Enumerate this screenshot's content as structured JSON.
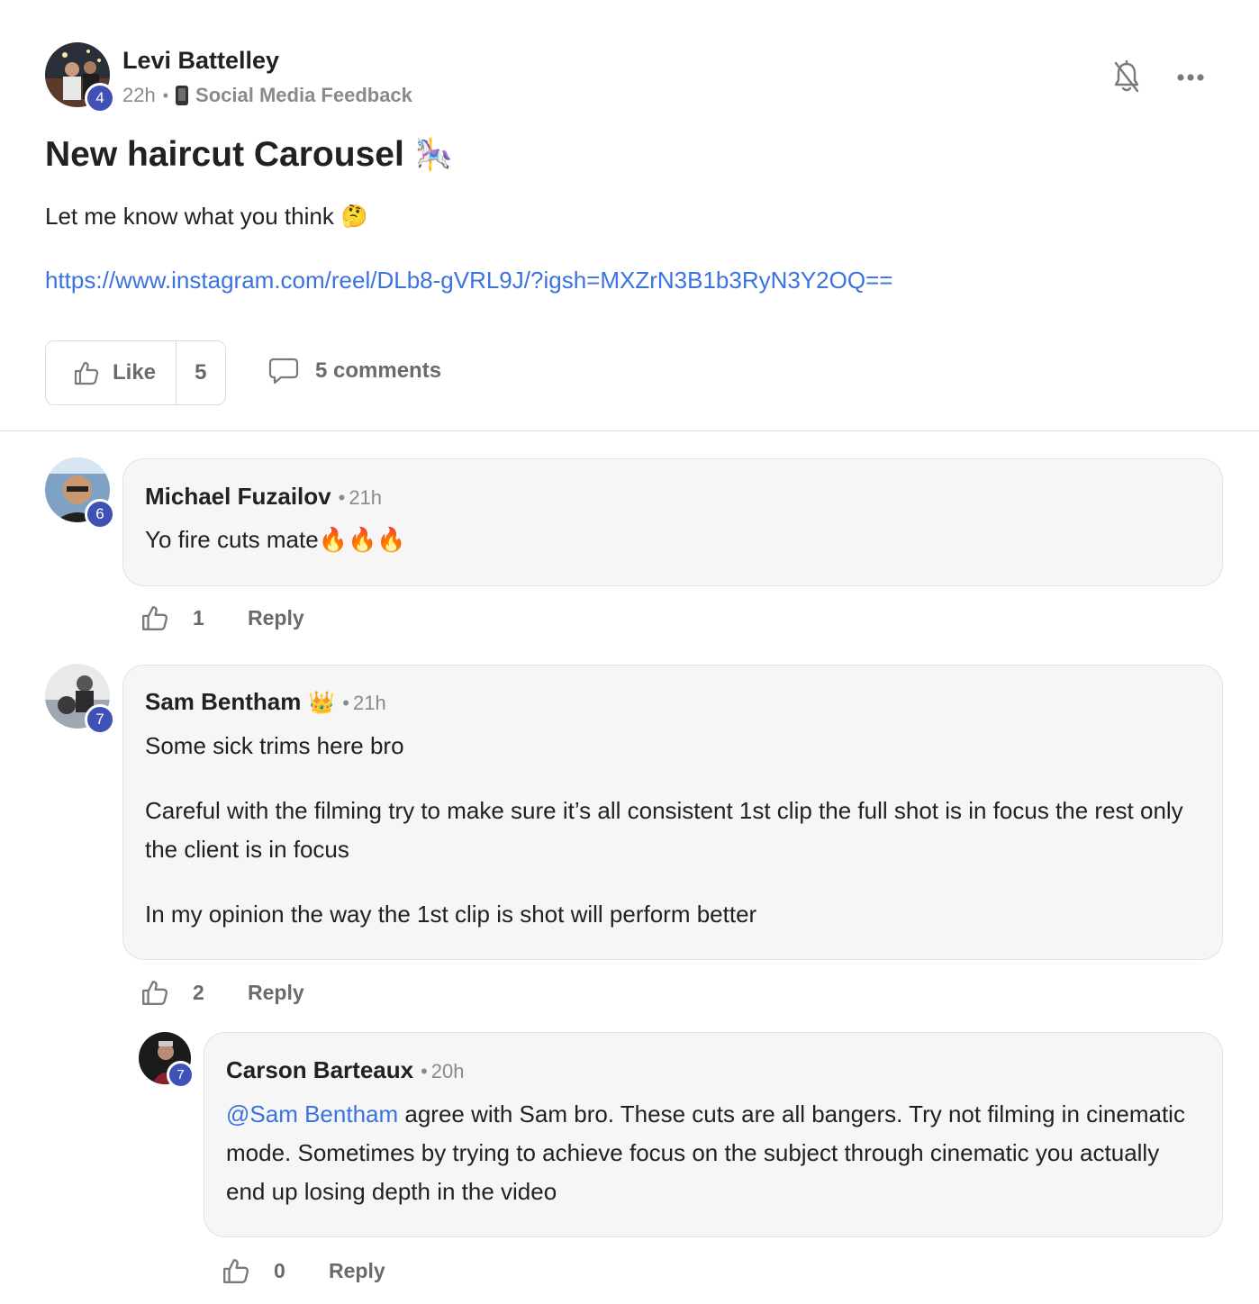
{
  "post": {
    "author": "Levi Battelley",
    "author_level": "4",
    "time": "22h",
    "separator": "•",
    "category": "Social Media Feedback",
    "category_icon": "phone-icon",
    "title": "New haircut Carousel",
    "title_emoji": "🎠",
    "body": "Let me know what you think",
    "body_emoji": "🤔",
    "link": "https://www.instagram.com/reel/DLb8-gVRL9J/?igsh=MXZrN3B1b3RyN3Y2OQ==",
    "like_label": "Like",
    "like_count": "5",
    "comments_label": "5 comments",
    "icons": {
      "notify": "bell-off-icon",
      "more": "more-horizontal-icon",
      "like": "thumbs-up-icon",
      "comment": "speech-bubble-icon"
    }
  },
  "comments": [
    {
      "author": "Michael Fuzailov",
      "level": "6",
      "time": "21h",
      "separator": "•",
      "text": "Yo fire cuts mate🔥🔥🔥",
      "likes": "1",
      "reply_label": "Reply"
    },
    {
      "author": "Sam Bentham",
      "author_emoji": "👑",
      "level": "7",
      "time": "21h",
      "separator": "•",
      "paragraphs": [
        "Some sick trims here bro",
        "Careful with the filming try to make sure it’s all consistent 1st clip the full shot is in focus the rest only the client is in focus",
        "In my opinion the way the 1st clip is shot will perform better"
      ],
      "likes": "2",
      "reply_label": "Reply"
    },
    {
      "author": "Carson Barteaux",
      "level": "7",
      "time": "20h",
      "separator": "•",
      "mention": "@Sam Bentham",
      "text": " agree with Sam bro. These cuts are all bangers. Try not filming in cinematic mode. Sometimes by trying to achieve focus on the subject through cinematic you actually end up losing depth in the video",
      "likes": "0",
      "reply_label": "Reply"
    }
  ],
  "colors": {
    "accent": "#3f51b5",
    "link": "#3a72e0",
    "muted": "#8a8a8a",
    "bubble": "#f6f6f6"
  }
}
